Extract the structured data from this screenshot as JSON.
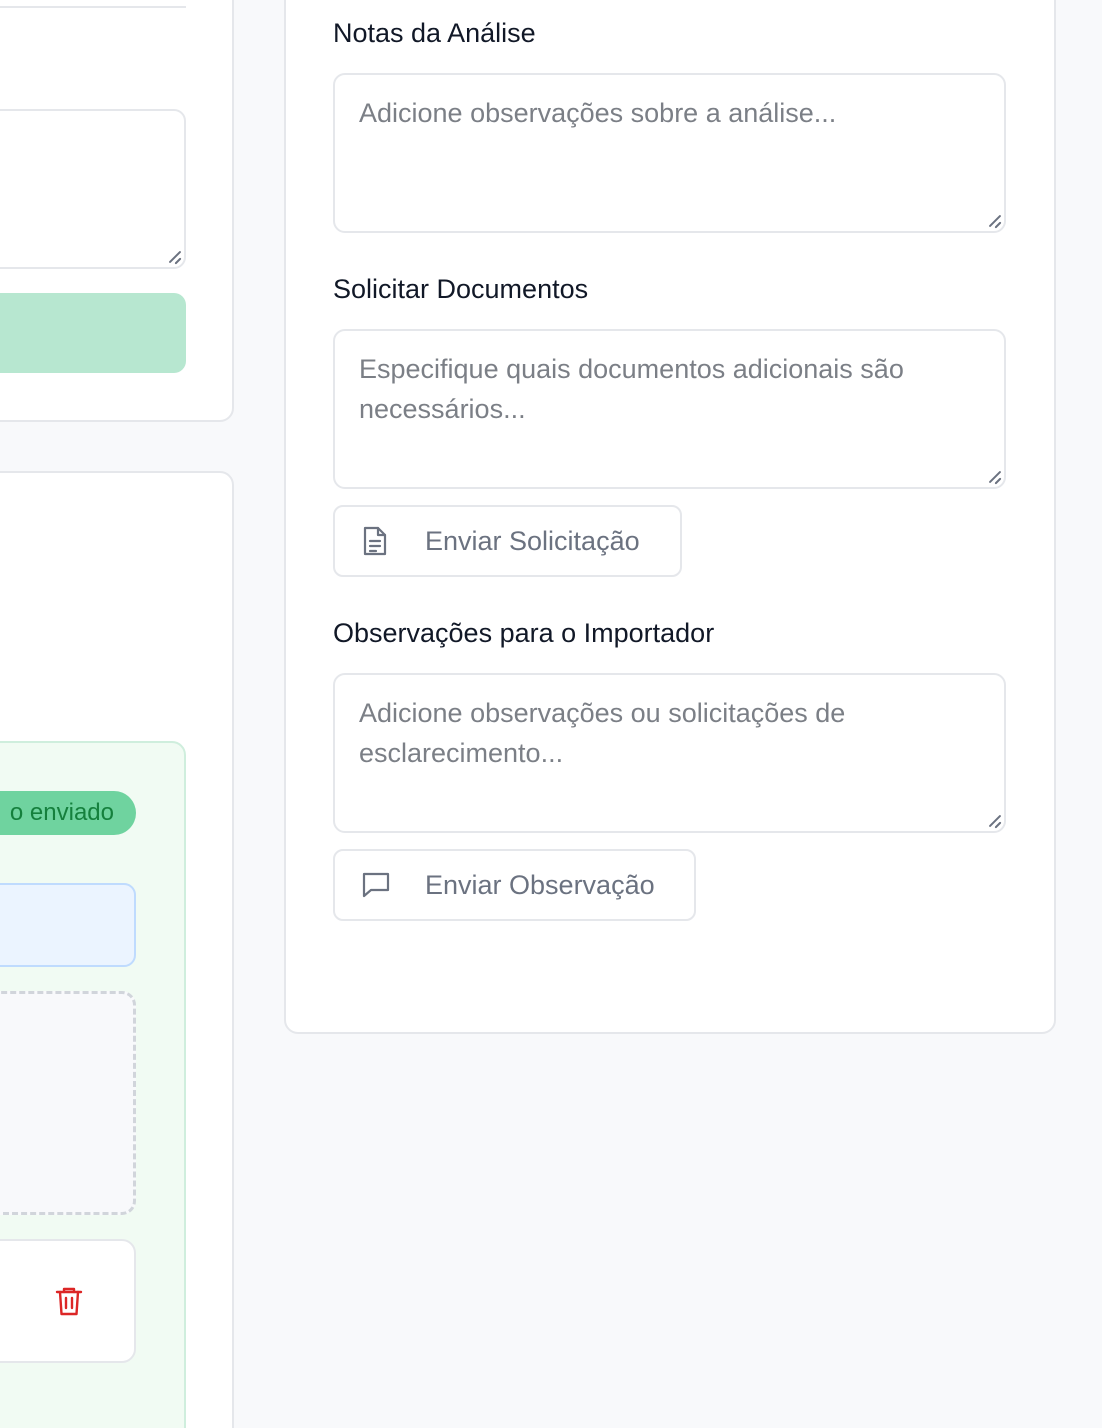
{
  "analysis_panel": {
    "notes": {
      "label": "Notas da Análise",
      "placeholder": "Adicione observações sobre a análise..."
    },
    "request_documents": {
      "label": "Solicitar Documentos",
      "placeholder": "Especifique quais documentos adicionais são necessários...",
      "button_label": "Enviar Solicitação",
      "button_icon": "document-icon"
    },
    "importer_notes": {
      "label": "Observações para o Importador",
      "placeholder": "Adicione observações ou solicitações de esclarecimento...",
      "button_label": "Enviar Observação",
      "button_icon": "message-icon"
    }
  },
  "left_panel": {
    "status_badge": "o enviado",
    "delete_icon": "trash-icon"
  },
  "colors": {
    "page_background": "#f8f9fb",
    "card_border": "#e5e7eb",
    "green_button": "#b7e7d0",
    "status_badge": "#6fd39f",
    "info_box": "#ebf4ff",
    "danger": "#dc2626",
    "placeholder_text": "#7b7f86"
  }
}
